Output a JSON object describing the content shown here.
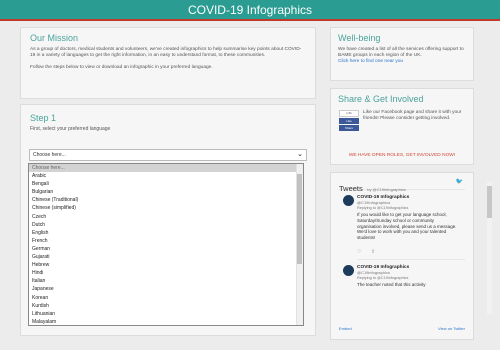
{
  "header": {
    "title": "COVID-19 Infographics"
  },
  "mission": {
    "title": "Our Mission",
    "body": "As a group of doctors, medical students and volunteers, we've created infographics to help summarise key points about COVID-19 in a variety of languages to get the right information, in an easy to understand format, to these communities.",
    "follow": "Follow the steps below to view or download an infographic in your preferred language."
  },
  "step1": {
    "title": "Step 1",
    "subtitle": "First, select your preferred language",
    "select_value": "Choose here...",
    "options": [
      "Choose here...",
      "Arabic",
      "Bengali",
      "Bulgarian",
      "Chinese (Traditional)",
      "Chinese (simplified)",
      "Czech",
      "Dutch",
      "English",
      "French",
      "German",
      "Gujarati",
      "Hebrew",
      "Hindi",
      "Italian",
      "Japanese",
      "Korean",
      "Kurdish",
      "Lithuanian",
      "Malayalam"
    ]
  },
  "wellbeing": {
    "title": "Well-being",
    "body": "We have created a list of all the services offering support to BAME groups in each region of the UK.",
    "link": "Click here to find one near you"
  },
  "share": {
    "title": "Share & Get Involved",
    "fb_like": "Like",
    "fb_count": "1.5k",
    "fb_share": "Share",
    "body": "Like our Facebook page and share it with your friends! Please consider getting involved.",
    "roles": "WE HAVE OPEN ROLES, GET INVOLVED NOW!"
  },
  "tweets": {
    "title": "Tweets",
    "by": "by @C19Infographics",
    "items": [
      {
        "name": "COVID-19 Infographics",
        "handle": "@C19Infographics",
        "reply": "Replying to @C19infographics",
        "text": "If you would like to get your language school, Saturday/Sunday school or community organisation involved, please send us a message. We'd love to work with you and your talented students!"
      },
      {
        "name": "COVID-19 Infographics",
        "handle": "@C19infographics",
        "reply": "Replying to @C19infographics",
        "text": "The teacher noted that this activity"
      }
    ],
    "embed": "Embed",
    "view": "View on Twitter"
  },
  "colors": {
    "accent": "#2a9c92",
    "banner_border": "#c0392b",
    "link": "#2a74c9",
    "roles": "#d64532"
  }
}
